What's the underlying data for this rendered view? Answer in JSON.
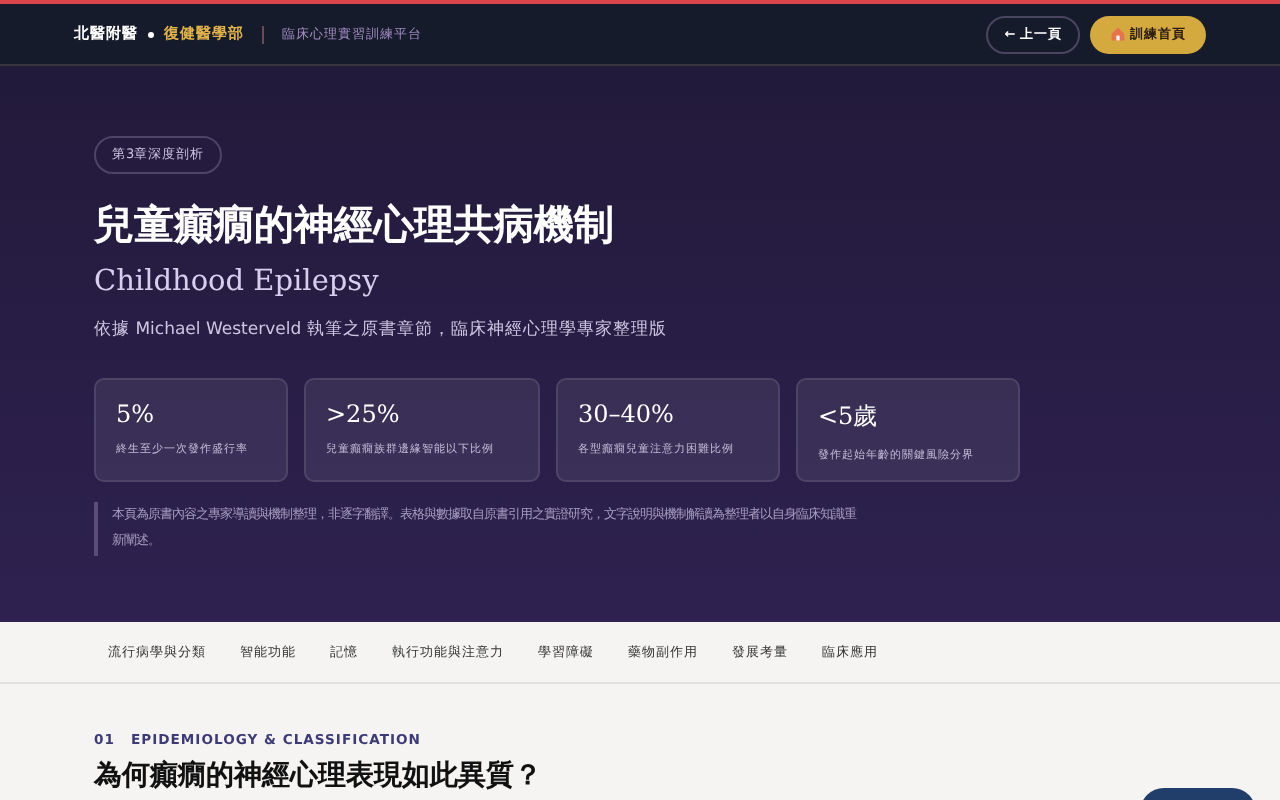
{
  "header": {
    "brand": "北醫附醫",
    "brand_dept": "復健醫學部",
    "platform": "臨床心理實習訓練平台",
    "back_button": "← 上一頁",
    "home_button": "訓練首頁"
  },
  "hero": {
    "badge": "第3章深度剖析",
    "title": "兒童癲癇的神經心理共病機制",
    "subtitle_en": "Childhood Epilepsy",
    "byline": "依據 Michael Westerveld 執筆之原書章節，臨床神經心理學專家整理版",
    "stats": [
      {
        "value": "5%",
        "label": "終生至少一次發作盛行率"
      },
      {
        "value": ">25%",
        "label": "兒童癲癇族群邊緣智能以下比例"
      },
      {
        "value": "30–40%",
        "label": "各型癲癇兒童注意力困難比例"
      },
      {
        "value": "<5歲",
        "label": "發作起始年齡的關鍵風險分界"
      }
    ],
    "note": "本頁為原書內容之專家導讀與機制整理，非逐字翻譯。表格與數據取自原書引用之實證研究，文字說明與機制解讀為整理者以自身臨床知識重新闡述。"
  },
  "nav": [
    {
      "label": "流行病學與分類"
    },
    {
      "label": "智能功能"
    },
    {
      "label": "記憶"
    },
    {
      "label": "執行功能與注意力"
    },
    {
      "label": "學習障礙"
    },
    {
      "label": "藥物副作用"
    },
    {
      "label": "發展考量"
    },
    {
      "label": "臨床應用"
    }
  ],
  "section": {
    "number": "01",
    "eyebrow": "EPIDEMIOLOGY & CLASSIFICATION",
    "heading": "為何癲癇的神經心理表現如此異質？"
  }
}
